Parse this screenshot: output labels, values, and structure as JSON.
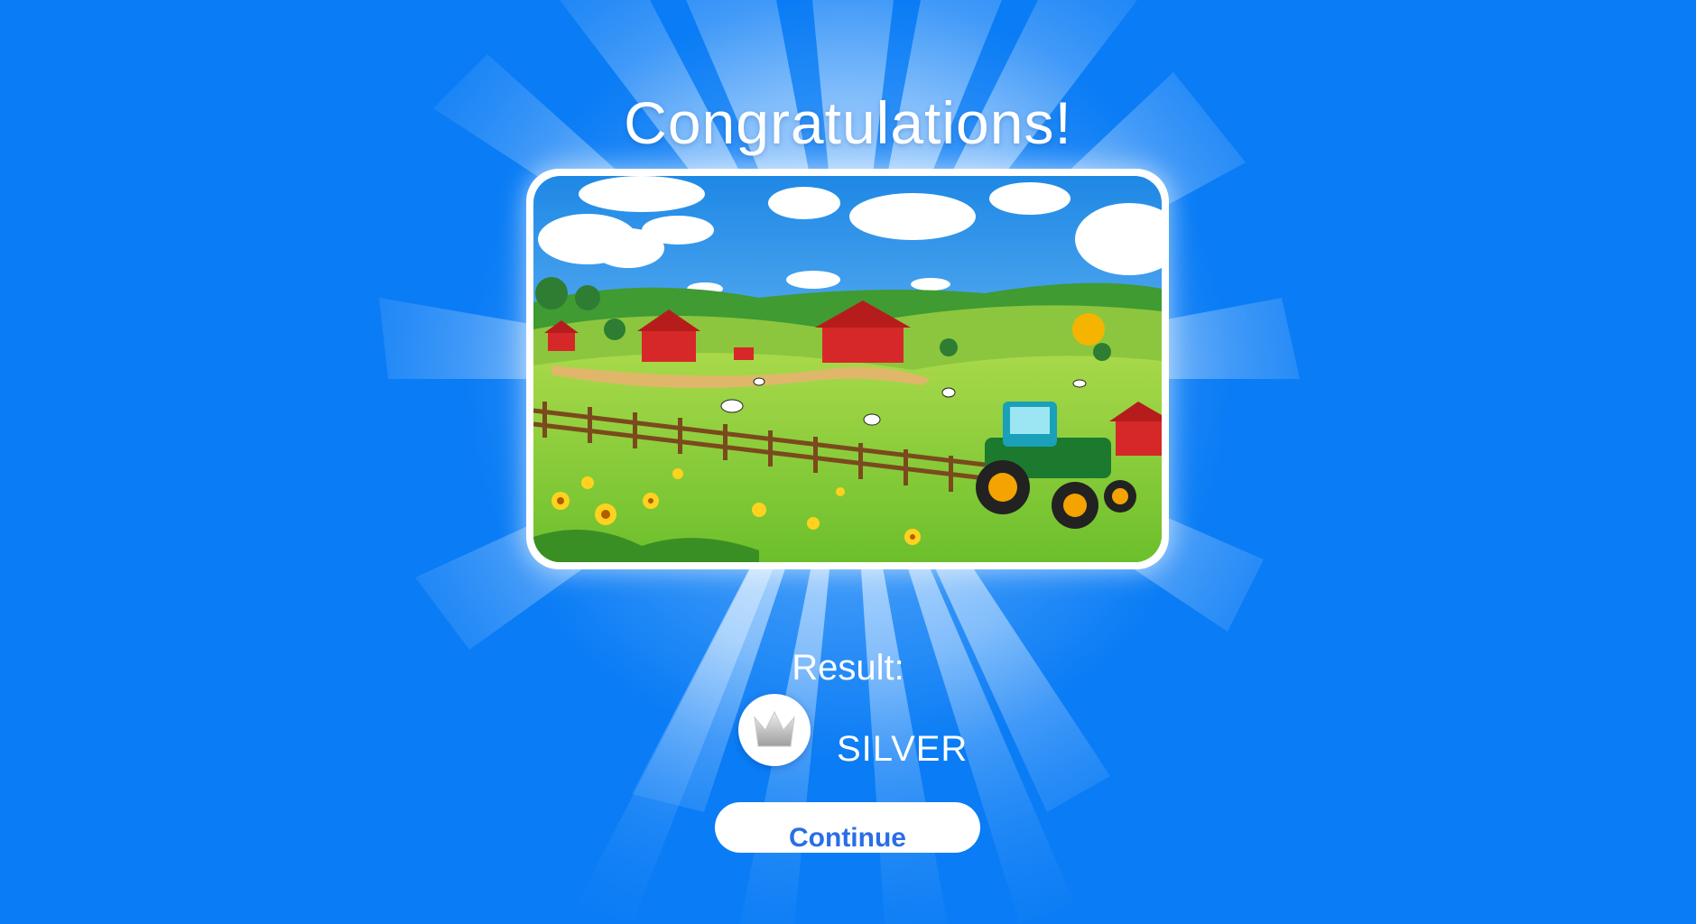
{
  "screen": {
    "title": "Congratulations!",
    "background_color": "#0a7cf5",
    "accent_color": "#2a6ee6"
  },
  "illustration": {
    "scene": "farm-scene-image",
    "icon": "farm-illustration"
  },
  "result": {
    "label": "Result:",
    "medal_icon": "crown-icon",
    "rank": "SILVER"
  },
  "actions": {
    "continue_label": "Continue"
  }
}
